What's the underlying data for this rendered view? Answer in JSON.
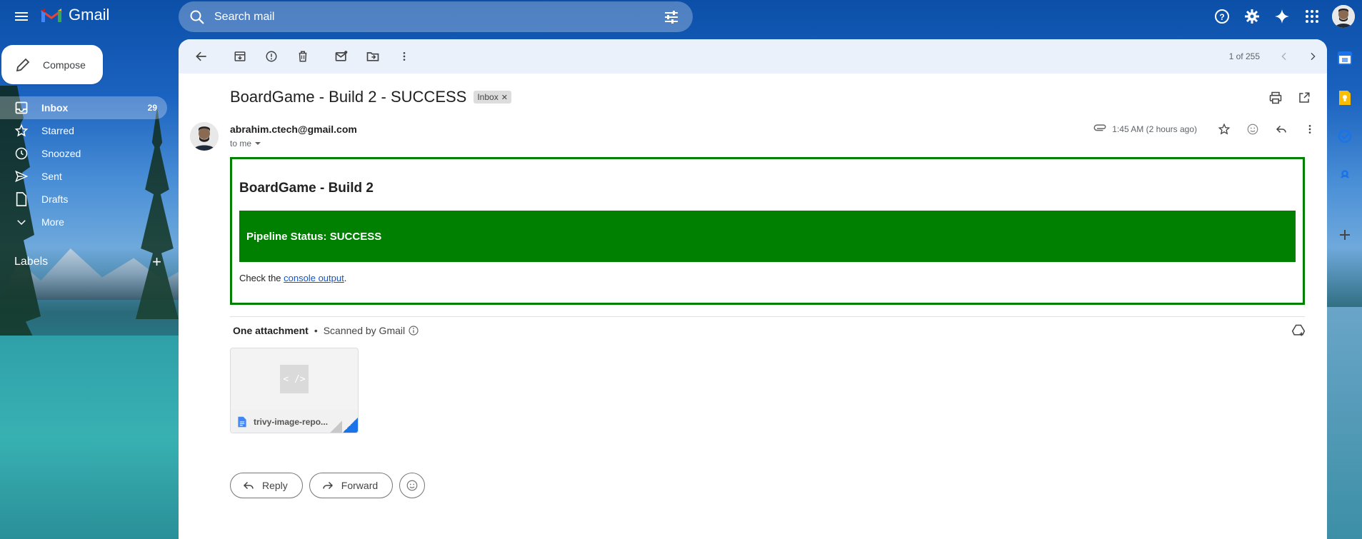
{
  "app": {
    "name": "Gmail"
  },
  "search": {
    "placeholder": "Search mail"
  },
  "compose": {
    "label": "Compose"
  },
  "nav": {
    "items": [
      {
        "label": "Inbox",
        "count": "29",
        "icon": "inbox-icon"
      },
      {
        "label": "Starred",
        "count": "",
        "icon": "star-icon"
      },
      {
        "label": "Snoozed",
        "count": "",
        "icon": "clock-icon"
      },
      {
        "label": "Sent",
        "count": "",
        "icon": "send-icon"
      },
      {
        "label": "Drafts",
        "count": "",
        "icon": "draft-icon"
      },
      {
        "label": "More",
        "count": "",
        "icon": "chevron-down-icon"
      }
    ],
    "labels_heading": "Labels"
  },
  "pager": {
    "text": "1 of 255"
  },
  "message": {
    "subject": "BoardGame - Build 2 - SUCCESS",
    "label_chip": "Inbox",
    "sender": "abrahim.ctech@gmail.com",
    "to": "to me",
    "timestamp": "1:45 AM (2 hours ago)"
  },
  "email_body": {
    "title": "BoardGame - Build 2",
    "status": "Pipeline Status: SUCCESS",
    "console_prefix": "Check the ",
    "console_link": "console output",
    "console_suffix": ".",
    "colors": {
      "status_bg": "#008000",
      "border": "#008000",
      "link": "#1155cc"
    }
  },
  "attachments": {
    "title": "One attachment",
    "scan_text": "Scanned by Gmail",
    "file_name": "trivy-image-repo...",
    "thumb_glyph": "< />"
  },
  "actions": {
    "reply": "Reply",
    "forward": "Forward"
  }
}
